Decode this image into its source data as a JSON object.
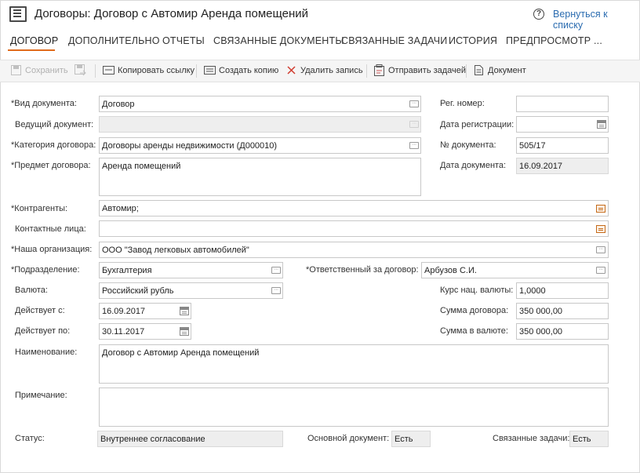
{
  "header": {
    "title": "Договоры: Договор с Автомир Аренда помещений",
    "help_glyph": "?",
    "back_link": "Вернуться к списку"
  },
  "tabs": [
    {
      "label": "ДОГОВОР",
      "active": true
    },
    {
      "label": "ДОПОЛНИТЕЛЬНО"
    },
    {
      "label": "ОТЧЕТЫ"
    },
    {
      "label": "СВЯЗАННЫЕ ДОКУМЕНТЫ"
    },
    {
      "label": "СВЯЗАННЫЕ ЗАДАЧИ"
    },
    {
      "label": "ИСТОРИЯ"
    },
    {
      "label": "ПРЕДПРОСМОТР"
    },
    {
      "label": "..."
    }
  ],
  "toolbar": {
    "save": "Сохранить",
    "copy_link": "Копировать ссылку",
    "create_copy": "Создать копию",
    "delete": "Удалить запись",
    "send_task": "Отправить задачей",
    "document": "Документ"
  },
  "form": {
    "doc_type": {
      "label": "*Вид документа:",
      "value": "Договор"
    },
    "lead_doc": {
      "label": "Ведущий документ:",
      "value": ""
    },
    "contract_cat": {
      "label": "*Категория договора:",
      "value": "Договоры аренды недвижимости (Д000010)"
    },
    "subject": {
      "label": "*Предмет договора:",
      "value": "Аренда помещений"
    },
    "reg_num": {
      "label": "Рег. номер:",
      "value": ""
    },
    "reg_date": {
      "label": "Дата регистрации:",
      "value": ""
    },
    "doc_num": {
      "label": "№ документа:",
      "value": "505/17"
    },
    "doc_date": {
      "label": "Дата документа:",
      "value": "16.09.2017"
    },
    "contractors": {
      "label": "*Контрагенты:",
      "value": "Автомир;"
    },
    "contacts": {
      "label": "Контактные лица:",
      "value": ""
    },
    "our_org": {
      "label": "*Наша организация:",
      "value": "ООО \"Завод легковых автомобилей\""
    },
    "department": {
      "label": "*Подразделение:",
      "value": "Бухгалтерия"
    },
    "responsible": {
      "label": "*Ответственный за договор:",
      "value": "Арбузов С.И."
    },
    "currency": {
      "label": "Валюта:",
      "value": "Российский рубль"
    },
    "rate": {
      "label": "Курс нац. валюты:",
      "value": "1,0000"
    },
    "valid_from": {
      "label": "Действует с:",
      "value": "16.09.2017"
    },
    "amount": {
      "label": "Сумма договора:",
      "value": "350 000,00"
    },
    "valid_to": {
      "label": "Действует по:",
      "value": "30.11.2017"
    },
    "amount_cur": {
      "label": "Сумма в валюте:",
      "value": "350 000,00"
    },
    "name": {
      "label": "Наименование:",
      "value": "Договор с Автомир Аренда помещений"
    },
    "note": {
      "label": "Примечание:",
      "value": ""
    },
    "status": {
      "label": "Статус:",
      "value": "Внутреннее согласование"
    },
    "main_doc": {
      "label": "Основной документ:",
      "value": "Есть"
    },
    "linked_tasks": {
      "label": "Связанные задачи:",
      "value": "Есть"
    }
  },
  "colors": {
    "accent_tab": "#e06b1c",
    "link": "#2b6cb0",
    "delete_icon": "#d03a2e"
  }
}
